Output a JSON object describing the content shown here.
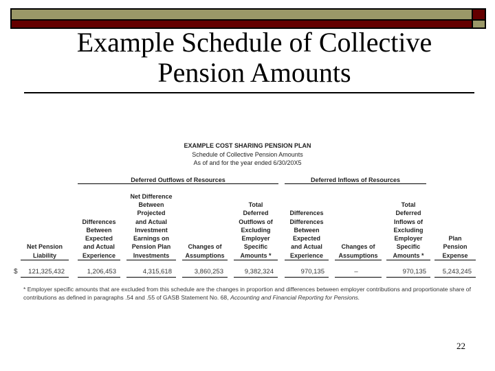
{
  "colors": {
    "olive": "#9a9868",
    "maroon": "#640000"
  },
  "slide": {
    "title_line1": "Example Schedule of Collective",
    "title_line2": "Pension Amounts",
    "page_number": "22"
  },
  "table": {
    "plan_name": "EXAMPLE COST SHARING PENSION PLAN",
    "subtitle": "Schedule of Collective Pension Amounts",
    "period": "As of and for the year ended 6/30/20X5",
    "group_outflows": "Deferred Outflows of Resources",
    "group_inflows": "Deferred Inflows of Resources",
    "currency_symbol": "$",
    "columns": [
      {
        "header": "Net Pension\nLiability",
        "value": "121,325,432"
      },
      {
        "header": "Differences\nBetween\nExpected\nand Actual\nExperience",
        "value": "1,206,453"
      },
      {
        "header": "Net Difference\nBetween\nProjected\nand Actual\nInvestment\nEarnings on\nPension Plan\nInvestments",
        "value": "4,315,618"
      },
      {
        "header": "Changes of\nAssumptions",
        "value": "3,860,253"
      },
      {
        "header": "Total\nDeferred\nOutflows of\nExcluding\nEmployer\nSpecific\nAmounts *",
        "value": "9,382,324"
      },
      {
        "header": "Differences\nDifferences\nBetween\nExpected\nand Actual\nExperience",
        "value": "970,135"
      },
      {
        "header": "Changes of\nAssumptions",
        "value": "–"
      },
      {
        "header": "Total\nDeferred\nInflows of\nExcluding\nEmployer\nSpecific\nAmounts *",
        "value": "970,135"
      },
      {
        "header": "Plan\nPension\nExpense",
        "value": "5,243,245"
      }
    ],
    "footnote_main": "* Employer specific amounts that are excluded from this schedule are the changes in proportion and differences between employer contributions and proportionate share of contributions as defined in paragraphs .54 and .55 of GASB Statement No. 68, ",
    "footnote_italic": "Accounting and Financial Reporting for Pensions."
  }
}
